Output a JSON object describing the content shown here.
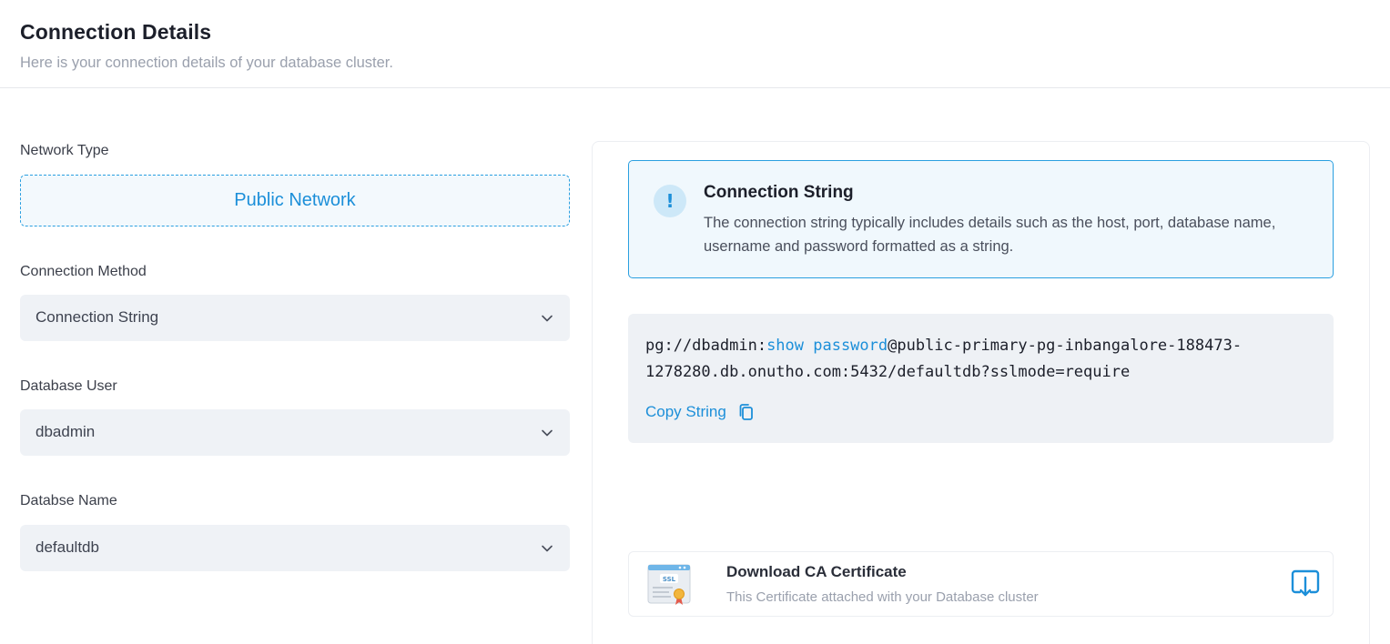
{
  "header": {
    "title": "Connection Details",
    "subtitle": "Here is your connection details of your database cluster."
  },
  "form": {
    "network_type": {
      "label": "Network Type",
      "value": "Public Network"
    },
    "connection_method": {
      "label": "Connection Method",
      "value": "Connection String"
    },
    "database_user": {
      "label": "Database User",
      "value": "dbadmin"
    },
    "database_name": {
      "label": "Databse Name",
      "value": "defaultdb"
    }
  },
  "info": {
    "title": "Connection String",
    "description": "The connection string typically includes details such as the host, port, database name, username and password formatted as a string.",
    "icon": "exclamation-icon"
  },
  "connection": {
    "prefix": "pg://dbadmin:",
    "password_toggle": "show password",
    "suffix": "@public-primary-pg-inbangalore-188473-1278280.db.onutho.com:5432/defaultdb?sslmode=require",
    "copy_label": "Copy String"
  },
  "certificate": {
    "title": "Download CA Certificate",
    "description": "This Certificate attached with your Database cluster",
    "badge": "SSL"
  },
  "colors": {
    "accent": "#1c8fd9",
    "info_bg": "#f0f8fd",
    "select_bg": "#eff2f6"
  }
}
